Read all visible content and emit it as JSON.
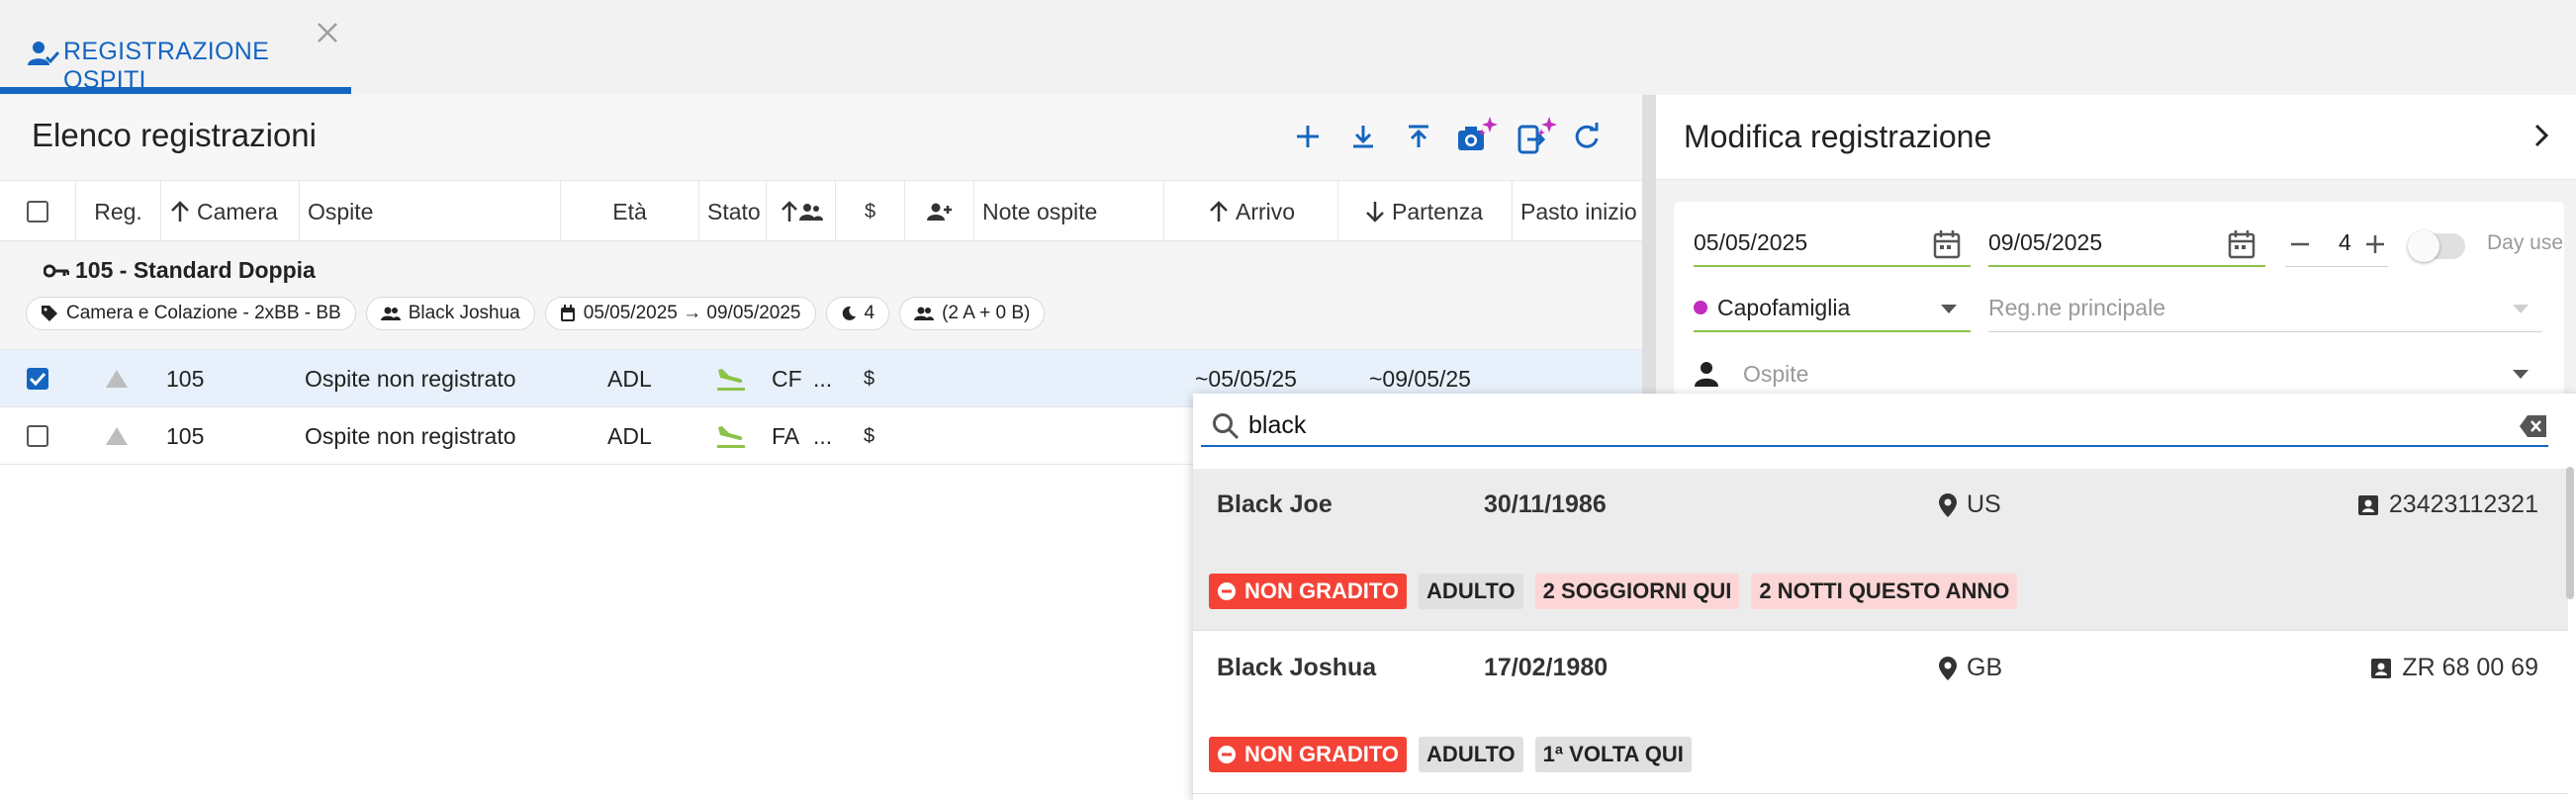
{
  "tab": {
    "label": "REGISTRAZIONE OSPITI"
  },
  "left": {
    "title": "Elenco registrazioni",
    "columns": {
      "reg": "Reg.",
      "camera": "Camera",
      "ospite": "Ospite",
      "eta": "Età",
      "stato": "Stato",
      "currency": "$",
      "note": "Note ospite",
      "arrivo": "Arrivo",
      "partenza": "Partenza",
      "pasto": "Pasto inizio"
    },
    "group": {
      "title": "105 - Standard Doppia",
      "chips": {
        "rate": "Camera e Colazione - 2xBB - BB",
        "guest": "Black Joshua",
        "dates": "05/05/2025 → 09/05/2025",
        "nights": "4",
        "pax": "(2 A + 0 B)"
      }
    },
    "rows": [
      {
        "camera": "105",
        "ospite": "Ospite non registrato",
        "eta": "ADL",
        "type": "CF",
        "ellipsis": "...",
        "currency": "$",
        "arrivo": "~05/05/25",
        "partenza": "~09/05/25"
      },
      {
        "camera": "105",
        "ospite": "Ospite non registrato",
        "eta": "ADL",
        "type": "FA",
        "ellipsis": "...",
        "currency": "$"
      }
    ]
  },
  "right": {
    "title": "Modifica registrazione",
    "form": {
      "date_from": "05/05/2025",
      "date_to": "09/05/2025",
      "nights": "4",
      "day_use": "Day use",
      "role": "Capofamiglia",
      "main_reg_placeholder": "Reg.ne principale",
      "guest_placeholder": "Ospite"
    }
  },
  "dropdown": {
    "search_value": "black",
    "results": [
      {
        "name": "Black Joe",
        "dob": "30/11/1986",
        "country": "US",
        "doc": "23423112321",
        "badges": {
          "b1": "NON GRADITO",
          "b2": "ADULTO",
          "b3": "2 SOGGIORNI QUI",
          "b4": "2 NOTTI QUESTO ANNO"
        }
      },
      {
        "name": "Black Joshua",
        "dob": "17/02/1980",
        "country": "GB",
        "doc": "ZR 68 00 69",
        "badges": {
          "b1": "NON GRADITO",
          "b2": "ADULTO",
          "b3": "1ª VOLTA QUI"
        }
      }
    ]
  },
  "colors": {
    "primary": "#1565c0",
    "accent_green": "#8bc34a",
    "danger": "#f44336",
    "magenta": "#c12cc1"
  }
}
